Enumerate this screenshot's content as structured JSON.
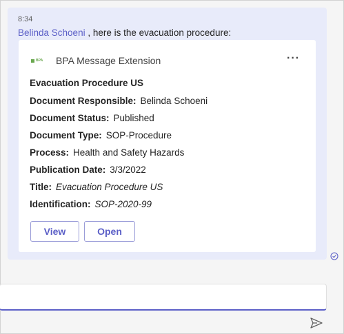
{
  "message": {
    "timestamp": "8:34",
    "mention": "Belinda Schoeni",
    "text": " , here is the evacuation procedure:"
  },
  "card": {
    "app_logo_text": "BPA",
    "app_name": "BPA Message Extension",
    "more_label": "···",
    "title": "Evacuation Procedure US",
    "facts": [
      {
        "label": "Document Responsible:",
        "value": "Belinda Schoeni",
        "italic": false
      },
      {
        "label": "Document Status:",
        "value": "Published",
        "italic": false
      },
      {
        "label": "Document Type:",
        "value": "SOP-Procedure",
        "italic": false
      },
      {
        "label": "Process:",
        "value": "Health and Safety Hazards",
        "italic": false
      },
      {
        "label": "Publication Date:",
        "value": "3/3/2022",
        "italic": false
      },
      {
        "label": "Title:",
        "value": "Evacuation Procedure US",
        "italic": true
      },
      {
        "label": "Identification:",
        "value": "SOP-2020-99",
        "italic": true
      }
    ],
    "buttons": {
      "view": "View",
      "open": "Open"
    }
  },
  "compose": {
    "value": ""
  },
  "colors": {
    "accent": "#5b5fc7",
    "bubble": "#e8ebfa",
    "logo_green": "#6aa84f"
  },
  "icons": {
    "status": "read-receipt-check-icon",
    "send": "send-icon",
    "more": "more-options-icon"
  }
}
